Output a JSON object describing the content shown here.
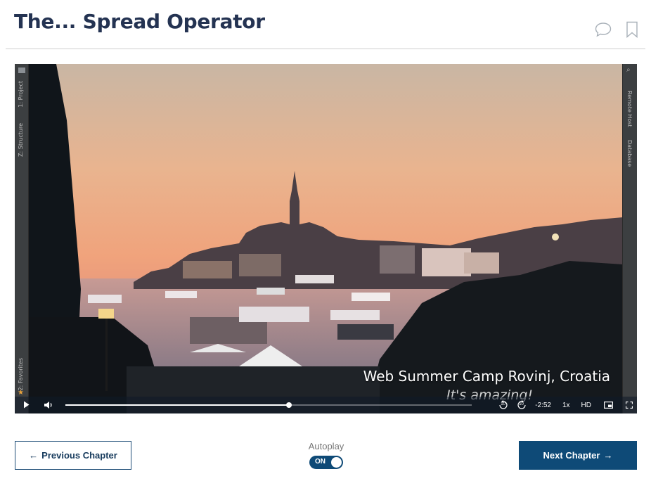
{
  "header": {
    "title": "The... Spread Operator",
    "icons": [
      "comment-icon",
      "bookmark-icon"
    ]
  },
  "ide": {
    "left_tabs": [
      "1: Project",
      "Z: Structure",
      "2: Favorites"
    ],
    "right_tabs": [
      "Remote Host",
      "Database"
    ]
  },
  "video": {
    "caption_title": "Web Summer Camp Rovinj, Croatia",
    "caption_sub": "It's amazing!",
    "progress": 0.55,
    "time_remaining": "-2:52",
    "speed": "1x",
    "quality": "HD",
    "rewind_label": "10",
    "forward_label": "10"
  },
  "footer": {
    "prev_label": "Previous Chapter",
    "next_label": "Next Chapter",
    "autoplay_label": "Autoplay",
    "autoplay_state": "ON"
  },
  "colors": {
    "title": "#243352",
    "primary": "#0e4a77"
  }
}
